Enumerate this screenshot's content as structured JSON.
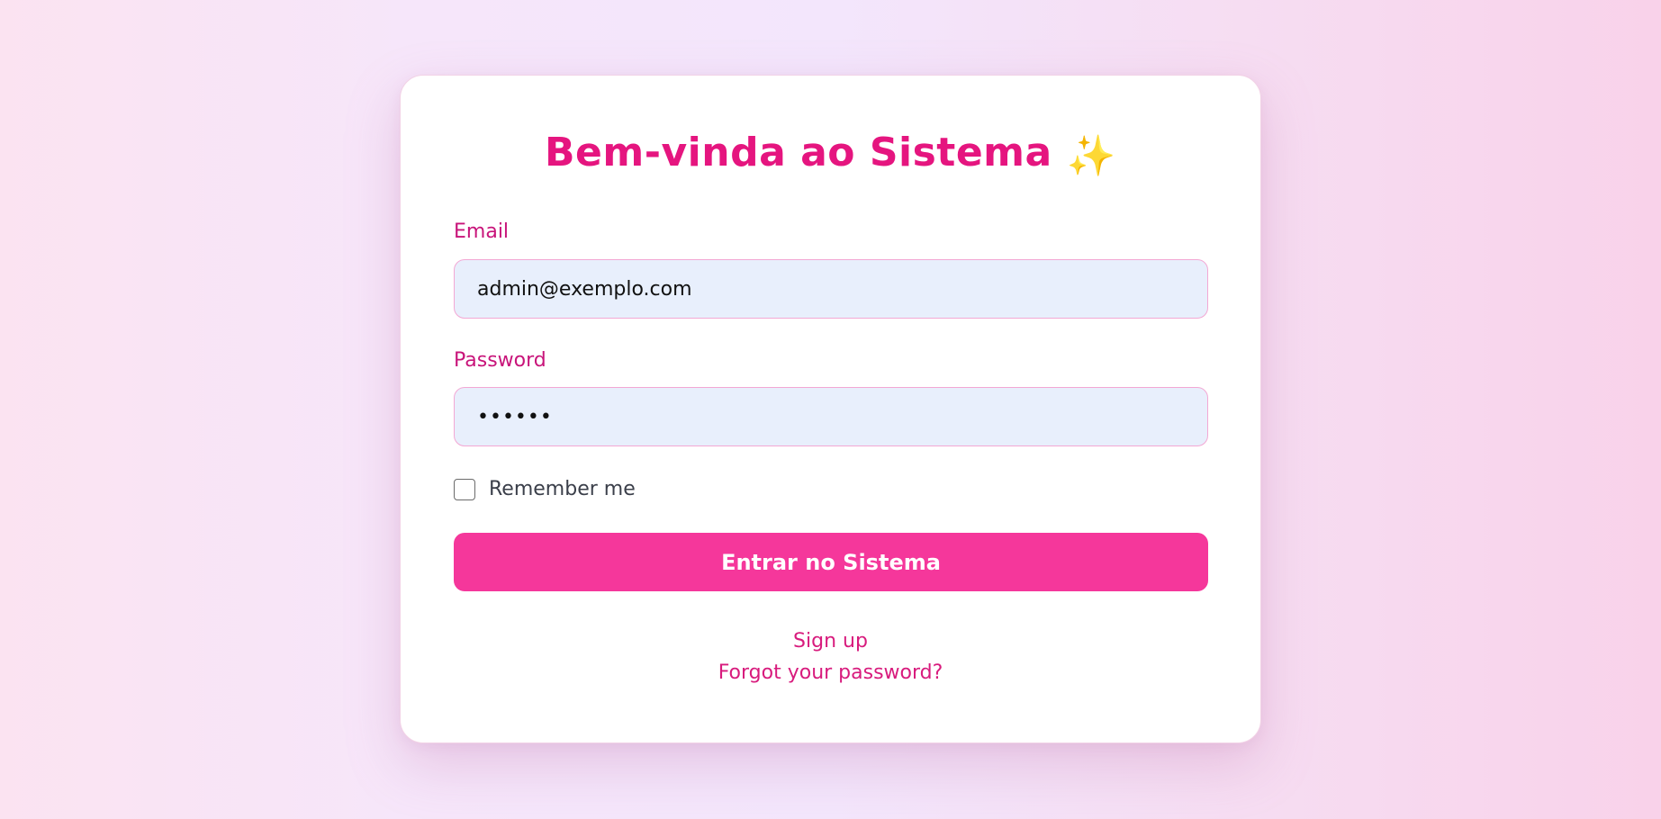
{
  "login": {
    "title": "Bem-vinda ao Sistema",
    "title_emoji": "✨",
    "email_label": "Email",
    "email_value": "admin@exemplo.com",
    "password_label": "Password",
    "password_value": "••••••",
    "remember_label": "Remember me",
    "remember_checked": false,
    "submit_label": "Entrar no Sistema",
    "signup_link": "Sign up",
    "forgot_link": "Forgot your password?"
  },
  "colors": {
    "accent": "#e5157f",
    "button": "#f5379b",
    "input_bg": "#e8effc",
    "input_border": "#f3a8d4"
  }
}
